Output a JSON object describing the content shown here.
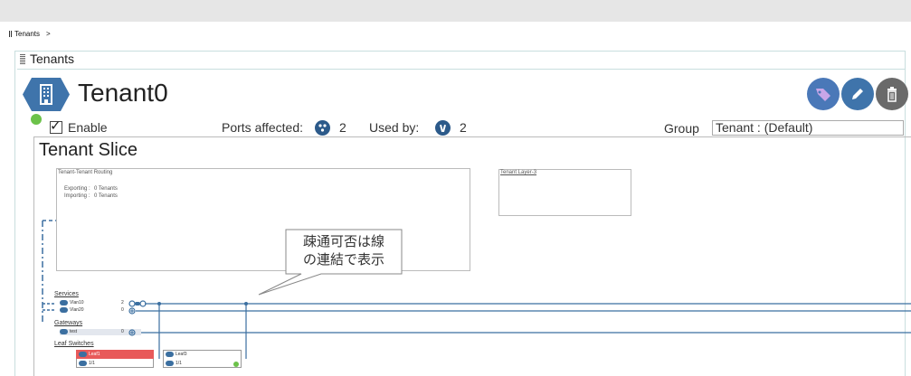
{
  "breadcrumb": {
    "item": "Tenants",
    "sep": ">"
  },
  "panel": {
    "title": "Tenants"
  },
  "tenant": {
    "name": "Tenant0",
    "enable_label": "Enable",
    "enabled": true
  },
  "stats": {
    "ports_affected_label": "Ports affected:",
    "ports_affected_value": "2",
    "used_by_label": "Used by:",
    "used_by_value": "2"
  },
  "group": {
    "label": "Group",
    "value": "Tenant : (Default)"
  },
  "actions": [
    "tag-icon",
    "pencil-icon",
    "trash-icon"
  ],
  "slice": {
    "title": "Tenant Slice",
    "routing": {
      "title": "Tenant-Tenant Routing",
      "exporting_label": "Exporting :",
      "exporting_value": "0 Tenants",
      "importing_label": "Importing :",
      "importing_value": "0 Tenants"
    },
    "layer3": {
      "title": "Tenant Layer-3"
    },
    "callout": {
      "line1": "疎通可否は線",
      "line2": "の連結で表示"
    },
    "services": {
      "label": "Services",
      "rows": [
        {
          "name": "Vlan10",
          "count": "2"
        },
        {
          "name": "Vlan20",
          "count": "0"
        }
      ]
    },
    "gateways": {
      "label": "Gateways",
      "rows": [
        {
          "name": "test",
          "count": "0"
        }
      ]
    },
    "leaf_switches": {
      "label": "Leaf Switches",
      "items": [
        {
          "name": "Leaf1",
          "port": "1/1",
          "alarm": true
        },
        {
          "name": "Leaf3",
          "port": "1/1",
          "alarm": false
        }
      ]
    }
  },
  "colors": {
    "accent": "#3b6fa0",
    "hex": "#3f74ab",
    "ok": "#6cc24a",
    "alarm": "#e85a5a",
    "tag_btn": "#4a78b8",
    "trash_btn": "#6a6a6a"
  }
}
